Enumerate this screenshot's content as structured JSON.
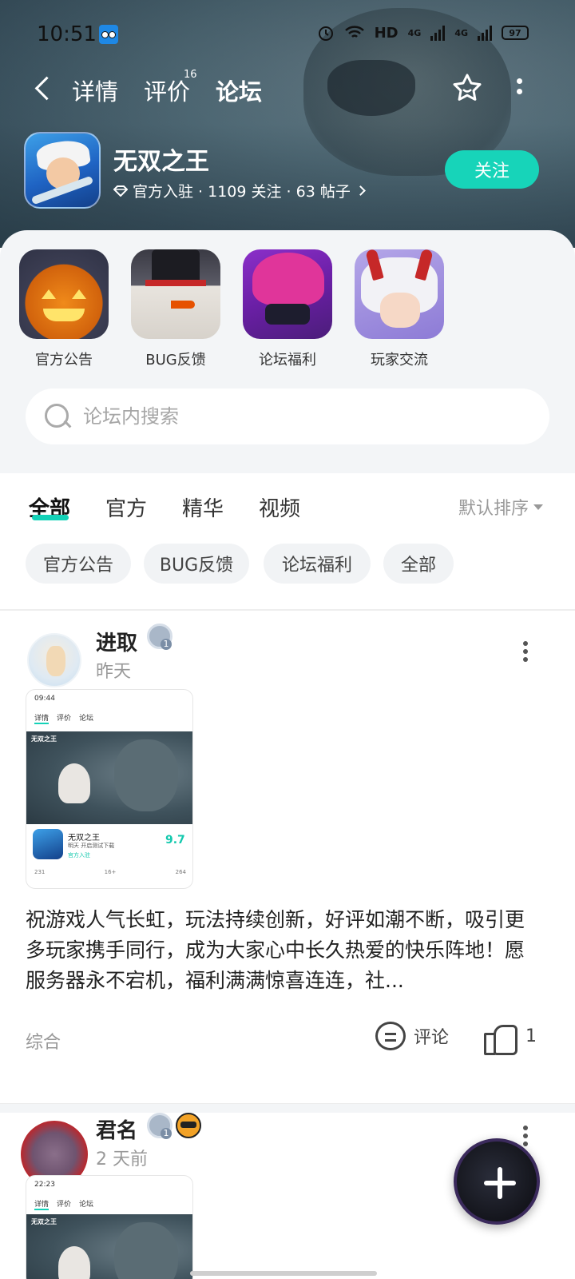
{
  "status_bar": {
    "time": "10:51",
    "hd": "HD",
    "net1": "4G",
    "net2": "4G",
    "battery": "97"
  },
  "top_nav": {
    "tabs": [
      {
        "label": "详情"
      },
      {
        "label": "评价",
        "count": "16"
      },
      {
        "label": "论坛",
        "active": true
      }
    ]
  },
  "app": {
    "name": "无双之王",
    "meta": "官方入驻 · 1109 关注 · 63 帖子",
    "follow_label": "关注"
  },
  "boards": [
    {
      "label": "官方公告"
    },
    {
      "label": "BUG反馈"
    },
    {
      "label": "论坛福利"
    },
    {
      "label": "玩家交流"
    }
  ],
  "search": {
    "placeholder": "论坛内搜索"
  },
  "filter_tabs": [
    "全部",
    "官方",
    "精华",
    "视频"
  ],
  "sort_label": "默认排序",
  "chips": [
    "官方公告",
    "BUG反馈",
    "论坛福利",
    "全部"
  ],
  "posts": [
    {
      "username": "进取",
      "time": "昨天",
      "text": "祝游戏人气长虹，玩法持续创新，好评如潮不断，吸引更多玩家携手同行，成为大家心中长久热爱的快乐阵地！愿服务器永不宕机，福利满满惊喜连连，社...",
      "category": "综合",
      "comment_label": "评论",
      "likes": "1",
      "screenshot": {
        "time": "09:44",
        "tabs": [
          "详情",
          "评价",
          "论坛"
        ],
        "banner_tag": "无双之王",
        "title": "无双之王",
        "sub": "明天 开启测试下载",
        "verified": "官方入驻",
        "score": "9.7",
        "stats": [
          "231",
          "16+",
          "264"
        ]
      }
    },
    {
      "username": "君名",
      "time": "2 天前",
      "screenshot": {
        "time": "22:23",
        "tabs": [
          "详情",
          "评价",
          "论坛"
        ],
        "banner_tag": "无双之王"
      }
    }
  ],
  "colors": {
    "accent": "#14d2b8",
    "hero_bg": "#55707c"
  }
}
